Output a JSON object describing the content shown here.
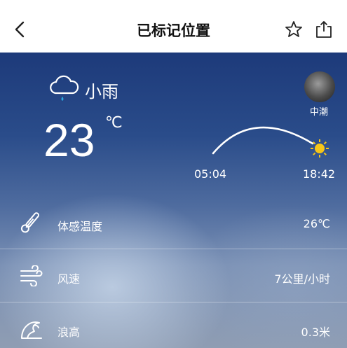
{
  "header": {
    "title": "已标记位置",
    "back_icon": "chevron-left-icon",
    "favorite_icon": "star-icon",
    "share_icon": "share-icon"
  },
  "weather": {
    "condition": "小雨",
    "condition_icon": "light-rain-cloud-icon",
    "temperature": "23",
    "temperature_unit": "℃"
  },
  "tide": {
    "label": "中潮",
    "moon_icon": "moon-icon"
  },
  "sun": {
    "sunrise": "05:04",
    "sunset": "18:42",
    "sun_icon": "sun-icon"
  },
  "details": [
    {
      "label": "体感温度",
      "value": "26℃",
      "icon": "thermometer-icon"
    },
    {
      "label": "风速",
      "value": "7公里/小时",
      "icon": "wind-icon"
    },
    {
      "label": "浪高",
      "value": "0.3米",
      "icon": "wave-icon"
    }
  ],
  "colors": {
    "panel_top": "#1d3a7a",
    "panel_bottom": "#8f9db3",
    "sun": "#f5c518",
    "rain_drop": "#29a8e0"
  }
}
